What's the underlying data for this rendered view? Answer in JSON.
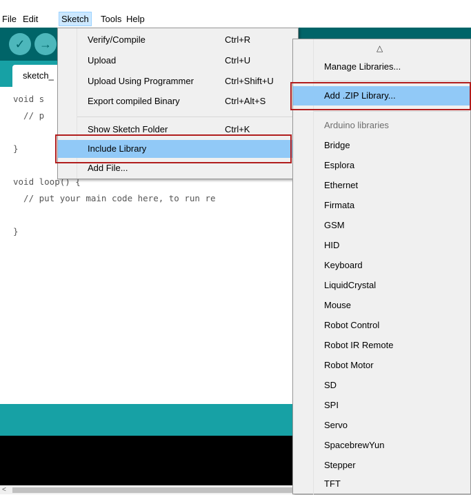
{
  "menubar": {
    "items": [
      "File",
      "Edit",
      "Sketch",
      "Tools",
      "Help"
    ]
  },
  "toolbar": {
    "verify_glyph": "✓",
    "upload_glyph": "→"
  },
  "tab": {
    "label": "sketch_"
  },
  "editor": {
    "lines": [
      "void s",
      "  // p",
      "}",
      "void loop() {",
      "  // put your main code here, to run re",
      "}"
    ]
  },
  "sketch_menu": {
    "items": [
      {
        "label": "Verify/Compile",
        "shortcut": "Ctrl+R"
      },
      {
        "label": "Upload",
        "shortcut": "Ctrl+U"
      },
      {
        "label": "Upload Using Programmer",
        "shortcut": "Ctrl+Shift+U"
      },
      {
        "label": "Export compiled Binary",
        "shortcut": "Ctrl+Alt+S"
      },
      {
        "label": "Show Sketch Folder",
        "shortcut": "Ctrl+K"
      },
      {
        "label": "Include Library",
        "shortcut": ""
      },
      {
        "label": "Add File...",
        "shortcut": ""
      }
    ]
  },
  "library_menu": {
    "scroll_up_glyph": "△",
    "manage": "Manage Libraries...",
    "add_zip": "Add .ZIP Library...",
    "section_header": "Arduino libraries",
    "libraries": [
      "Bridge",
      "Esplora",
      "Ethernet",
      "Firmata",
      "GSM",
      "HID",
      "Keyboard",
      "LiquidCrystal",
      "Mouse",
      "Robot Control",
      "Robot IR Remote",
      "Robot Motor",
      "SD",
      "SPI",
      "Servo",
      "SpacebrewYun",
      "Stepper",
      "TFT"
    ]
  },
  "scrollbar": {
    "left_arrow": "<"
  },
  "colors": {
    "toolbar": "#006468",
    "tabstrip": "#17a1a5",
    "highlight": "#91c9f7",
    "annotation": "#b01c1c"
  }
}
